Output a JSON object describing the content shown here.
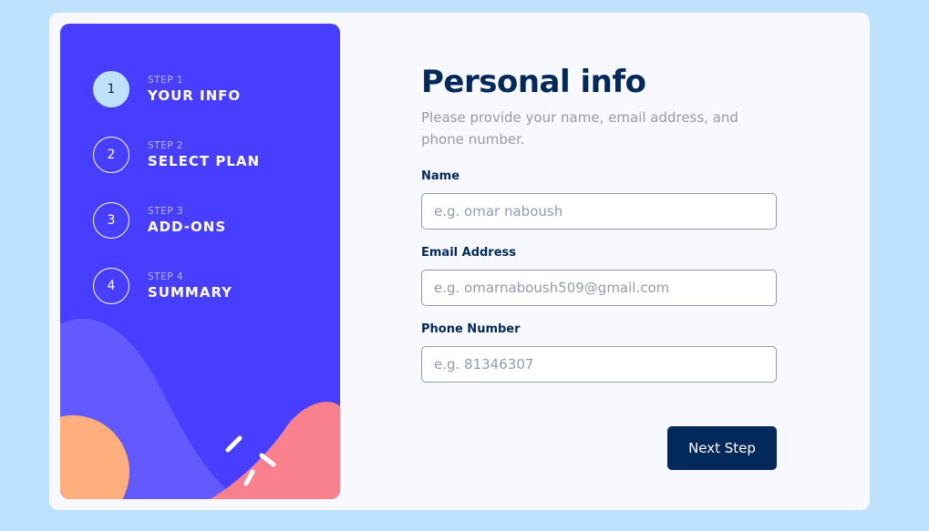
{
  "sidebar": {
    "steps": [
      {
        "number": "1",
        "label": "STEP 1",
        "title": "YOUR INFO",
        "active": true
      },
      {
        "number": "2",
        "label": "STEP 2",
        "title": "SELECT PLAN",
        "active": false
      },
      {
        "number": "3",
        "label": "STEP 3",
        "title": "ADD-ONS",
        "active": false
      },
      {
        "number": "4",
        "label": "STEP 4",
        "title": "SUMMARY",
        "active": false
      }
    ]
  },
  "form": {
    "title": "Personal info",
    "subtitle": "Please provide your name, email address, and phone number.",
    "fields": {
      "name": {
        "label": "Name",
        "placeholder": "e.g. omar naboush",
        "value": ""
      },
      "email": {
        "label": "Email Address",
        "placeholder": "e.g. omarnaboush509@gmail.com",
        "value": ""
      },
      "phone": {
        "label": "Phone Number",
        "placeholder": "e.g. 81346307",
        "value": ""
      }
    },
    "next_label": "Next Step"
  },
  "colors": {
    "page_bg": "#bee2fd",
    "sidebar_bg": "#483eff",
    "active_step": "#bee2fd",
    "primary": "#02295a",
    "muted": "#9699ab",
    "wave": "#6259ff",
    "orange": "#ffaf7e",
    "pink": "#f9818e"
  }
}
